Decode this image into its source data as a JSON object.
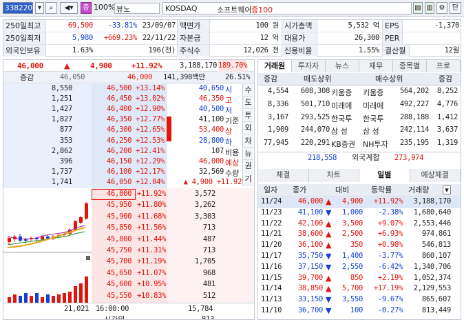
{
  "toolbar": {
    "code": "338220",
    "mode": "증",
    "zoom": "100%",
    "name": "뷰노",
    "market": "KOSDAQ",
    "sector": "소프트웨어",
    "margin": "증100",
    "btn_dan": "단"
  },
  "info": {
    "r1": [
      {
        "l": "250일최고",
        "v1": "69,500",
        "v2": "-33.81%",
        "v3": "23/09/07"
      },
      {
        "l": "액면가",
        "v": "100 원"
      },
      {
        "l": "시가총액",
        "v": "5,532 억"
      },
      {
        "l": "EPS",
        "v": "-1,370"
      }
    ],
    "r2": [
      {
        "l": "250일최저",
        "v1": "5,980",
        "v2": "+669.23%",
        "v3": "22/11/22"
      },
      {
        "l": "자본금",
        "v": "12 억"
      },
      {
        "l": "대용가",
        "v": "26,300"
      },
      {
        "l": "PER",
        "v": ""
      }
    ],
    "r3": [
      {
        "l": "외국인보유",
        "v1": "1.63%",
        "v3": "196(천)"
      },
      {
        "l": "주식수",
        "v": "12,026 천"
      },
      {
        "l": "신용비율",
        "v": "1.55%"
      },
      {
        "l": "결산월",
        "v": "12월"
      }
    ]
  },
  "price": {
    "cur": "46,000",
    "arrow": "▲",
    "chg": "4,900",
    "pct": "+11.92%",
    "vol": "3,188,170",
    "volpct": "189.70%",
    "lbl_inc": "증감",
    "v1": "46,050",
    "v2": "46,000",
    "amt": "141,398백만",
    "turn": "26.51%"
  },
  "asks": [
    {
      "q": "8,550",
      "p": "46,500",
      "r": "+13.14%"
    },
    {
      "q": "1,251",
      "p": "46,450",
      "r": "+13.02%"
    },
    {
      "q": "1,427",
      "p": "46,400",
      "r": "+12.90%"
    },
    {
      "q": "1,827",
      "p": "46,350",
      "r": "+12.77%"
    },
    {
      "q": "877",
      "p": "46,300",
      "r": "+12.65%"
    },
    {
      "q": "353",
      "p": "46,250",
      "r": "+12.53%"
    },
    {
      "q": "2,862",
      "p": "46,200",
      "r": "+12.41%"
    },
    {
      "q": "396",
      "p": "46,150",
      "r": "+12.29%"
    },
    {
      "q": "1,737",
      "p": "46,100",
      "r": "+12.17%"
    },
    {
      "q": "1,741",
      "p": "46,050",
      "r": "+12.04%"
    }
  ],
  "bids": [
    {
      "p": "46,000",
      "r": "+11.92%",
      "q": "3,572"
    },
    {
      "p": "45,950",
      "r": "+11.80%",
      "q": "3,262"
    },
    {
      "p": "45,900",
      "r": "+11.68%",
      "q": "3,303"
    },
    {
      "p": "45,850",
      "r": "+11.56%",
      "q": "713"
    },
    {
      "p": "45,800",
      "r": "+11.44%",
      "q": "487"
    },
    {
      "p": "45,750",
      "r": "+11.31%",
      "q": "713"
    },
    {
      "p": "45,700",
      "r": "+11.19%",
      "q": "1,705"
    },
    {
      "p": "45,650",
      "r": "+11.07%",
      "q": "968"
    },
    {
      "p": "45,600",
      "r": "+10.95%",
      "q": "481"
    },
    {
      "p": "45,550",
      "r": "+10.83%",
      "q": "512"
    }
  ],
  "stats": [
    {
      "v": "40,650",
      "c": "blue",
      "k": "시"
    },
    {
      "v": "46,350",
      "c": "red",
      "k": "고"
    },
    {
      "v": "40,500",
      "c": "blue",
      "k": "저"
    },
    {
      "v": "41,100",
      "c": "",
      "k": "기준"
    },
    {
      "v": "53,400",
      "c": "red",
      "k": "상"
    },
    {
      "v": "28,800",
      "c": "blue",
      "k": "하"
    },
    {
      "v": "107",
      "c": "",
      "k": "비용"
    },
    {
      "v": "46,000",
      "c": "red",
      "k": "예상"
    },
    {
      "v": "32,569",
      "c": "",
      "k": "수량"
    },
    {
      "v": "▲ 4,900 +11.92%",
      "c": "red",
      "k": ""
    }
  ],
  "vtabs": [
    "수",
    "도",
    "투",
    "외",
    "차",
    "뉴",
    "권",
    "기"
  ],
  "footer": {
    "ask_total": "21,021",
    "time": "16:00:00",
    "bid_total": "15,784",
    "time_lbl": "시간외",
    "after": "813"
  },
  "right_tabs": [
    "거래원",
    "투자자",
    "뉴스",
    "재무",
    "종목별",
    "프로"
  ],
  "broker_head": {
    "inc": "증감",
    "sell": "매도상위",
    "buy": "매수상위",
    "inc2": "증감"
  },
  "brokers": [
    {
      "a": "4,554",
      "b": "608,308",
      "n": "키움증",
      "n2": "키움증",
      "c": "564,202",
      "d": "8,252"
    },
    {
      "a": "8,336",
      "b": "501,710",
      "n": "미래에",
      "n2": "미래에",
      "c": "492,227",
      "d": "4,776"
    },
    {
      "a": "3,167",
      "b": "293,525",
      "n": "한국투",
      "n2": "한국투",
      "c": "288,188",
      "d": "1,412"
    },
    {
      "a": "1,909",
      "b": "244,070",
      "n": "삼 성",
      "n2": "삼 성",
      "c": "242,114",
      "d": "3,637"
    },
    {
      "a": "77,945",
      "b": "220,291",
      "n": "KB증권",
      "n2": "NH투자",
      "c": "235,195",
      "d": "1,319"
    }
  ],
  "foreign": {
    "sell": "218,558",
    "label": "외국계합",
    "buy": "273,974"
  },
  "lower_tabs": [
    "체결",
    "차트",
    "일별",
    "예상체결"
  ],
  "daily_head": [
    "일자",
    "종가",
    "대비",
    "등락률",
    "거래량"
  ],
  "daily": [
    {
      "d": "11/24",
      "p": "46,000",
      "s": "▲",
      "c": "4,900",
      "r": "+11.92%",
      "v": "3,188,170",
      "up": true
    },
    {
      "d": "11/23",
      "p": "41,100",
      "s": "▼",
      "c": "1,000",
      "r": "-2.38%",
      "v": "1,680,640",
      "up": false
    },
    {
      "d": "11/22",
      "p": "42,100",
      "s": "▲",
      "c": "3,500",
      "r": "+9.07%",
      "v": "2,553,446",
      "up": true
    },
    {
      "d": "11/21",
      "p": "38,600",
      "s": "▲",
      "c": "2,500",
      "r": "+6.93%",
      "v": "974,861",
      "up": true
    },
    {
      "d": "11/20",
      "p": "36,100",
      "s": "▲",
      "c": "350",
      "r": "+0.98%",
      "v": "546,813",
      "up": true
    },
    {
      "d": "11/17",
      "p": "35,750",
      "s": "▼",
      "c": "1,400",
      "r": "-3.77%",
      "v": "860,107",
      "up": false
    },
    {
      "d": "11/16",
      "p": "37,150",
      "s": "▼",
      "c": "2,550",
      "r": "-6.42%",
      "v": "1,340,706",
      "up": false
    },
    {
      "d": "11/15",
      "p": "39,700",
      "s": "▲",
      "c": "850",
      "r": "+2.19%",
      "v": "1,052,374",
      "up": true
    },
    {
      "d": "11/14",
      "p": "38,850",
      "s": "▲",
      "c": "5,700",
      "r": "+17.19%",
      "v": "2,129,553",
      "up": true
    },
    {
      "d": "11/13",
      "p": "33,150",
      "s": "▼",
      "c": "3,550",
      "r": "-9.67%",
      "v": "865,607",
      "up": false
    },
    {
      "d": "11/10",
      "p": "36,700",
      "s": "▼",
      "c": "100",
      "r": "-0.27%",
      "v": "813,449",
      "up": false
    }
  ]
}
